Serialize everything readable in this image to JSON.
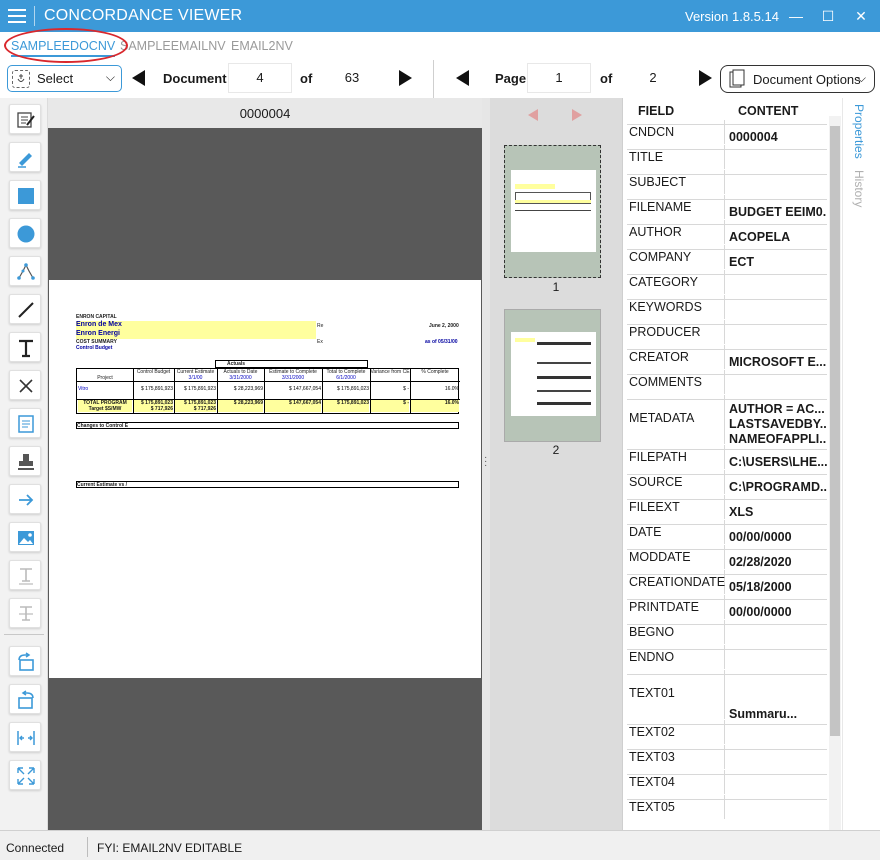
{
  "app": {
    "title": "CONCORDANCE VIEWER",
    "version": "Version 1.8.5.14",
    "minimize": "—",
    "maximize": "☐",
    "close": "✕"
  },
  "tabs": [
    {
      "label": "SAMPLEEDOCNV",
      "active": true
    },
    {
      "label": "SAMPLEEMAILNV",
      "active": false
    },
    {
      "label": "EMAIL2NV",
      "active": false
    }
  ],
  "toolbar": {
    "select_label": "Select",
    "document_label": "Document",
    "document_value": "4",
    "of_label": "of",
    "document_total": "63",
    "page_label": "Page",
    "page_value": "1",
    "page_of_label": "of",
    "page_total": "2",
    "doc_options_label": "Document Options"
  },
  "tools": [
    "annotate-icon",
    "highlighter-icon",
    "rectangle-icon",
    "circle-icon",
    "polygon-icon",
    "line-icon",
    "text-icon",
    "cross-icon",
    "note-icon",
    "stamp-icon",
    "arrow-icon",
    "image-icon",
    "underline-text-icon",
    "strikethrough-text-icon",
    "rotate-right-icon",
    "rotate-left-icon",
    "fit-width-icon",
    "fit-page-icon"
  ],
  "document": {
    "header_id": "0000004",
    "sheet": {
      "l1": "ENRON CAPITAL",
      "l2": "Enron de Mex",
      "l3": "Enron Energi",
      "l4": "COST SUMMARY",
      "l5": "Control Budget",
      "date": "June 2, 2000",
      "asof": "as of 05/31/00",
      "re": "Re",
      "ex": "Ex",
      "actuals": "Actuals",
      "cols": [
        "Project",
        "Control Budget",
        "Current Estimate",
        "Actuals to Date",
        "Estimate to Complete",
        "Total to Complete",
        "Variance from CE",
        "% Complete"
      ],
      "subcols": [
        "",
        "",
        "3/1/00",
        "3/31/2000",
        "3/31/2000",
        "6/1/2000",
        "",
        ""
      ],
      "row1": [
        "Vitro",
        "$ 175,891,923",
        "$ 175,891,923",
        "$ 28,223,969",
        "$ 147,667,054",
        "$ 175,891,023",
        "$ -",
        "16.0%"
      ],
      "row2a": [
        "TOTAL PROGRAM",
        "$ 175,891,023",
        "$ 175,891,023",
        "$ 28,223,969",
        "$ 147,667,054",
        "$ 175,891,023",
        "$ -",
        "16.0%"
      ],
      "row2b": [
        "Target $S/MW",
        "$ 717,926",
        "$ 717,926",
        "",
        "",
        "",
        "",
        ""
      ],
      "changes": "Changes to Control E",
      "current": "Current Estimate vs /"
    }
  },
  "thumbnails": [
    {
      "label": "1"
    },
    {
      "label": "2"
    }
  ],
  "properties": {
    "field_header": "FIELD",
    "content_header": "CONTENT",
    "rows": [
      {
        "field": "CNDCN",
        "content": "0000004"
      },
      {
        "field": "TITLE",
        "content": ""
      },
      {
        "field": "SUBJECT",
        "content": ""
      },
      {
        "field": "FILENAME",
        "content": "BUDGET EEIM0..."
      },
      {
        "field": "AUTHOR",
        "content": "ACOPELA"
      },
      {
        "field": "COMPANY",
        "content": "ECT"
      },
      {
        "field": "CATEGORY",
        "content": ""
      },
      {
        "field": "KEYWORDS",
        "content": ""
      },
      {
        "field": "PRODUCER",
        "content": ""
      },
      {
        "field": "CREATOR",
        "content": "MICROSOFT E..."
      },
      {
        "field": "COMMENTS",
        "content": ""
      },
      {
        "field": "METADATA",
        "content": "AUTHOR = AC...\nLASTSAVEDBY...\nNAMEOFAPPLI..."
      },
      {
        "field": "FILEPATH",
        "content": "C:\\USERS\\LHE..."
      },
      {
        "field": "SOURCE",
        "content": "C:\\PROGRAMD..."
      },
      {
        "field": "FILEEXT",
        "content": "XLS"
      },
      {
        "field": "DATE",
        "content": "00/00/0000"
      },
      {
        "field": "MODDATE",
        "content": "02/28/2020"
      },
      {
        "field": "CREATIONDATE",
        "content": "05/18/2000"
      },
      {
        "field": "PRINTDATE",
        "content": "00/00/0000"
      },
      {
        "field": "BEGNO",
        "content": ""
      },
      {
        "field": "ENDNO",
        "content": ""
      },
      {
        "field": "TEXT01",
        "content": "\n\nSummaru..."
      },
      {
        "field": "TEXT02",
        "content": ""
      },
      {
        "field": "TEXT03",
        "content": ""
      },
      {
        "field": "TEXT04",
        "content": ""
      },
      {
        "field": "TEXT05",
        "content": ""
      }
    ]
  },
  "side_tabs": {
    "properties": "Properties",
    "history": "History"
  },
  "status": {
    "connection": "Connected",
    "message": "FYI: EMAIL2NV EDITABLE"
  },
  "colors": {
    "accent": "#3c99d8",
    "highlight": "#ffff9e",
    "annotation": "#d9282d"
  }
}
